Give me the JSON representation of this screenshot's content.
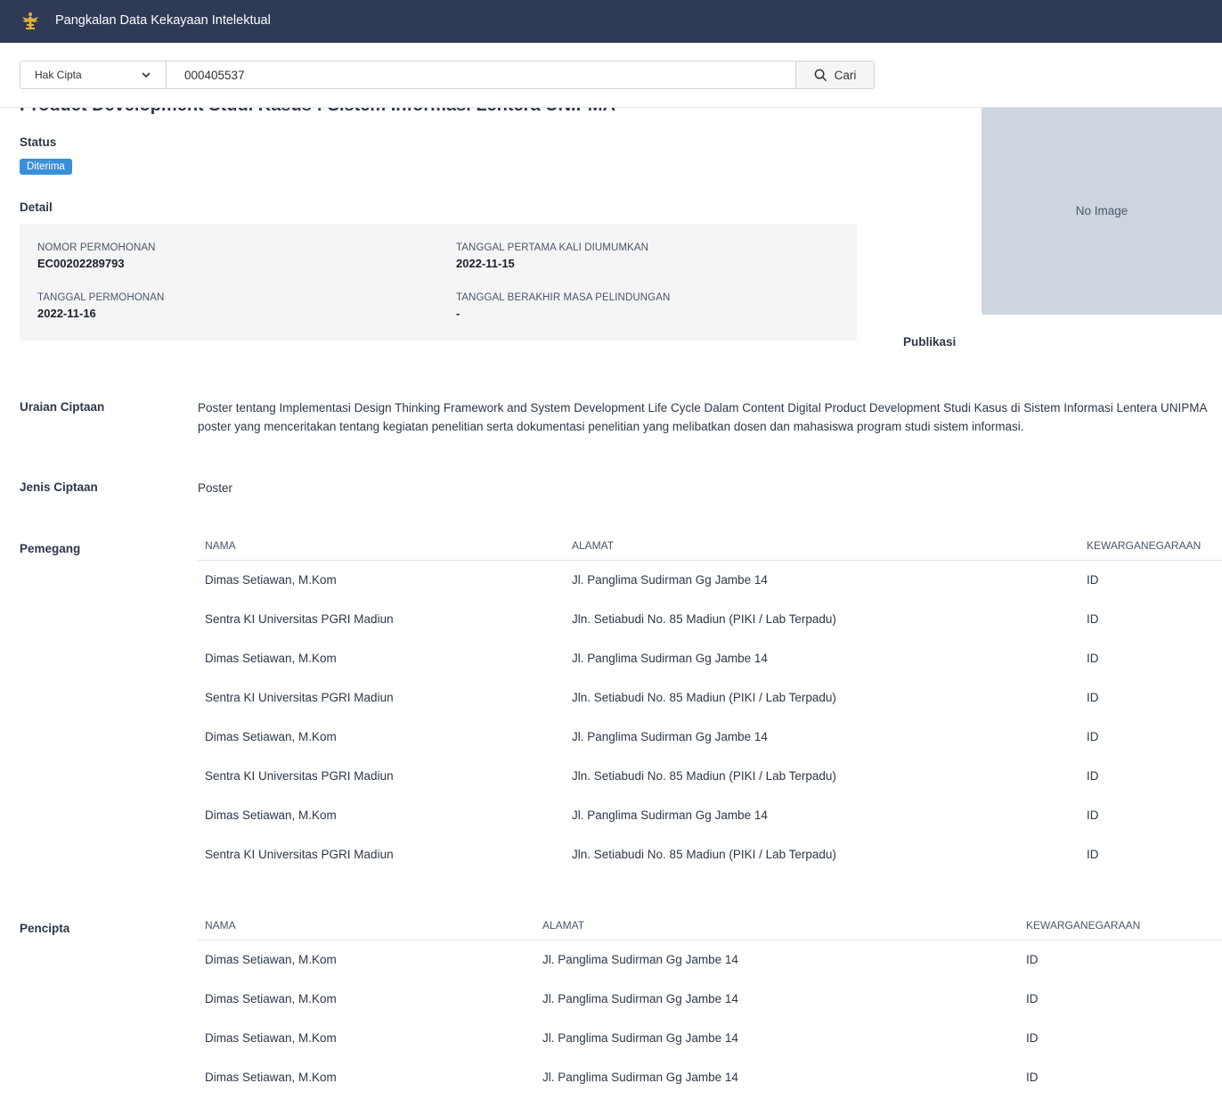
{
  "header": {
    "logo_icon": "garuda-emblem-icon",
    "title": "Pangkalan Data Kekayaan Intelektual"
  },
  "search": {
    "type_selected": "Hak Cipta",
    "query": "000405537",
    "button_label": "Cari"
  },
  "record": {
    "title": "Product Development Studi Kasus : Sistem Informasi Lentera UNIPMA",
    "status_label": "Status",
    "status_value": "Diterima",
    "detail_label": "Detail",
    "detail": {
      "nomor_permohonan_label": "NOMOR PERMOHONAN",
      "nomor_permohonan": "EC00202289793",
      "tanggal_permohonan_label": "TANGGAL PERMOHONAN",
      "tanggal_permohonan": "2022-11-16",
      "tanggal_diumumkan_label": "TANGGAL PERTAMA KALI DIUMUMKAN",
      "tanggal_diumumkan": "2022-11-15",
      "tanggal_berakhir_label": "TANGGAL BERAKHIR MASA PELINDUNGAN",
      "tanggal_berakhir": "-"
    },
    "no_image": "No Image",
    "publikasi_label": "Publikasi",
    "uraian_label": "Uraian Ciptaan",
    "uraian_line1": "Poster tentang Implementasi Design Thinking Framework and System Development Life Cycle Dalam Content Digital Product Development Studi Kasus di Sistem Informasi Lentera UNIPMA",
    "uraian_line2": "poster yang menceritakan tentang kegiatan penelitian serta dokumentasi penelitian yang melibatkan dosen dan mahasiswa program studi sistem informasi.",
    "jenis_label": "Jenis Ciptaan",
    "jenis_value": "Poster"
  },
  "pemegang": {
    "label": "Pemegang",
    "columns": [
      "NAMA",
      "ALAMAT",
      "KEWARGANEGARAAN"
    ],
    "rows": [
      [
        "Dimas Setiawan, M.Kom",
        "Jl. Panglima Sudirman Gg Jambe 14",
        "ID"
      ],
      [
        "Sentra KI Universitas PGRI Madiun",
        "Jln. Setiabudi No. 85 Madiun (PIKI / Lab Terpadu)",
        "ID"
      ],
      [
        "Dimas Setiawan, M.Kom",
        "Jl. Panglima Sudirman Gg Jambe 14",
        "ID"
      ],
      [
        "Sentra KI Universitas PGRI Madiun",
        "Jln. Setiabudi No. 85 Madiun (PIKI / Lab Terpadu)",
        "ID"
      ],
      [
        "Dimas Setiawan, M.Kom",
        "Jl. Panglima Sudirman Gg Jambe 14",
        "ID"
      ],
      [
        "Sentra KI Universitas PGRI Madiun",
        "Jln. Setiabudi No. 85 Madiun (PIKI / Lab Terpadu)",
        "ID"
      ],
      [
        "Dimas Setiawan, M.Kom",
        "Jl. Panglima Sudirman Gg Jambe 14",
        "ID"
      ],
      [
        "Sentra KI Universitas PGRI Madiun",
        "Jln. Setiabudi No. 85 Madiun (PIKI / Lab Terpadu)",
        "ID"
      ]
    ]
  },
  "pencipta": {
    "label": "Pencipta",
    "columns": [
      "NAMA",
      "ALAMAT",
      "KEWARGANEGARAAN"
    ],
    "rows": [
      [
        "Dimas Setiawan, M.Kom",
        "Jl. Panglima Sudirman Gg Jambe 14",
        "ID"
      ],
      [
        "Dimas Setiawan, M.Kom",
        "Jl. Panglima Sudirman Gg Jambe 14",
        "ID"
      ],
      [
        "Dimas Setiawan, M.Kom",
        "Jl. Panglima Sudirman Gg Jambe 14",
        "ID"
      ],
      [
        "Dimas Setiawan, M.Kom",
        "Jl. Panglima Sudirman Gg Jambe 14",
        "ID"
      ]
    ]
  }
}
